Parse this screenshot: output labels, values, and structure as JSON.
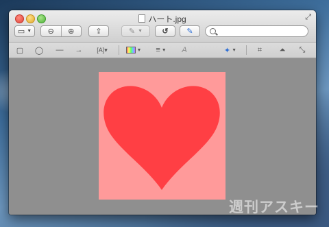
{
  "window": {
    "title": "ハート.jpg"
  },
  "toolbar": {
    "view_icon": "sidebar-view-icon",
    "zoom_out_icon": "zoom-out-icon",
    "zoom_in_icon": "zoom-in-icon",
    "share_icon": "share-icon",
    "annotate_icon": "pencil-icon",
    "rotate_icon": "rotate-icon",
    "edit_icon": "edit-toolbar-icon",
    "search_placeholder": ""
  },
  "markup_tools": [
    {
      "name": "rectangle-tool",
      "glyph": "▢"
    },
    {
      "name": "oval-tool",
      "glyph": "◯"
    },
    {
      "name": "line-tool",
      "glyph": "—"
    },
    {
      "name": "arrow-tool",
      "glyph": "→"
    },
    {
      "name": "text-box-tool",
      "glyph": "[A]"
    },
    {
      "name": "color-tool",
      "glyph": "▭"
    },
    {
      "name": "line-style-tool",
      "glyph": "≡"
    },
    {
      "name": "font-tool",
      "glyph": "A"
    },
    {
      "name": "instant-alpha-tool",
      "glyph": "⟋"
    },
    {
      "name": "crop-tool",
      "glyph": "⌗"
    },
    {
      "name": "adjust-color-tool",
      "glyph": "⏶"
    },
    {
      "name": "adjust-size-tool",
      "glyph": "⤡"
    }
  ],
  "image": {
    "background_color": "#ff9a9a",
    "heart_color": "#ff3f44"
  },
  "watermark": "週刊アスキー"
}
